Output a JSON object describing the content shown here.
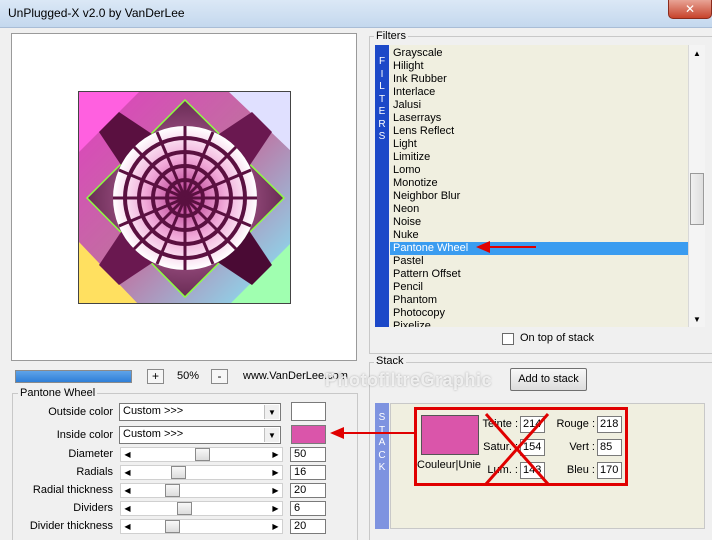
{
  "window": {
    "title": "UnPlugged-X v2.0 by VanDerLee",
    "close_glyph": "✕"
  },
  "preview": {
    "zoom_minus": "-",
    "zoom_plus": "+",
    "zoom": "50%",
    "url": "www.VanDerLee.com"
  },
  "watermark": "PhotofiltreGraphic",
  "pantone": {
    "title": "Pantone Wheel",
    "outside_label": "Outside color",
    "outside_value": "Custom >>>",
    "outside_color": "#ffffff",
    "inside_label": "Inside color",
    "inside_value": "Custom >>>",
    "inside_color": "#da55aa",
    "sliders": [
      {
        "label": "Diameter",
        "value": "50",
        "level": 0.5
      },
      {
        "label": "Radials",
        "value": "16",
        "level": 0.3
      },
      {
        "label": "Radial thickness",
        "value": "20",
        "level": 0.25
      },
      {
        "label": "Dividers",
        "value": "6",
        "level": 0.35
      },
      {
        "label": "Divider thickness",
        "value": "20",
        "level": 0.25
      }
    ]
  },
  "filters": {
    "title": "Filters",
    "side_label": [
      "F",
      "I",
      "L",
      "T",
      "E",
      "R",
      "S"
    ],
    "items": [
      "Grayscale",
      "Hilight",
      "Ink Rubber",
      "Interlace",
      "Jalusi",
      "Laserrays",
      "Lens Reflect",
      "Light",
      "Limitize",
      "Lomo",
      "Monotize",
      "Neighbor Blur",
      "Neon",
      "Noise",
      "Nuke",
      "Pantone Wheel",
      "Pastel",
      "Pattern Offset",
      "Pencil",
      "Phantom",
      "Photocopy",
      "Pixelize"
    ],
    "selected": "Pantone Wheel",
    "on_top_label": "On top of stack"
  },
  "stack": {
    "title": "Stack",
    "side_label": [
      "S",
      "T",
      "A",
      "C",
      "K"
    ],
    "add_button": "Add to stack"
  },
  "color_panel": {
    "swatch_color": "#da55aa",
    "label": "Couleur|Unie",
    "hsl": [
      {
        "label": "Teinte :",
        "value": "214"
      },
      {
        "label": "Satur. :",
        "value": "154"
      },
      {
        "label": "Lum. :",
        "value": "143"
      }
    ],
    "rgb": [
      {
        "label": "Rouge :",
        "value": "218"
      },
      {
        "label": "Vert :",
        "value": "85"
      },
      {
        "label": "Bleu :",
        "value": "170"
      }
    ]
  },
  "colors": {
    "accent": "#e00000",
    "selection": "#3a9cf0",
    "filters_side": "#1c48c8",
    "stack_side": "#7e93e0"
  }
}
